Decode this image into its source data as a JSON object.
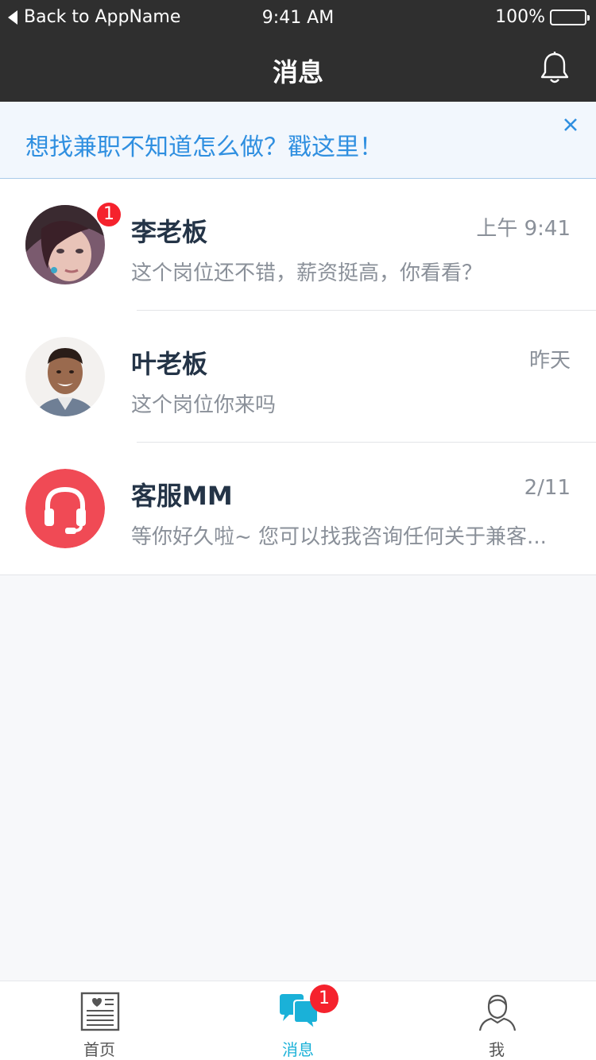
{
  "status_bar": {
    "back_text": "Back to AppName",
    "time": "9:41 AM",
    "battery": "100%"
  },
  "navbar": {
    "title": "消息"
  },
  "banner": {
    "text": "想找兼职不知道怎么做？戳这里！"
  },
  "messages": [
    {
      "name": "李老板",
      "time": "上午 9:41",
      "preview": "这个岗位还不错，薪资挺高，你看看？",
      "badge": "1"
    },
    {
      "name": "叶老板",
      "time": "昨天",
      "preview": "这个岗位你来吗"
    },
    {
      "name": "客服MM",
      "time": "2/11",
      "preview": "等你好久啦~ 您可以找我咨询任何关于兼客..."
    }
  ],
  "tabbar": {
    "home": "首页",
    "messages": "消息",
    "messages_badge": "1",
    "me": "我"
  },
  "colors": {
    "accent": "#1ab1d8",
    "link": "#2f8fe0",
    "badge": "#f5222d",
    "service": "#f04a55"
  }
}
